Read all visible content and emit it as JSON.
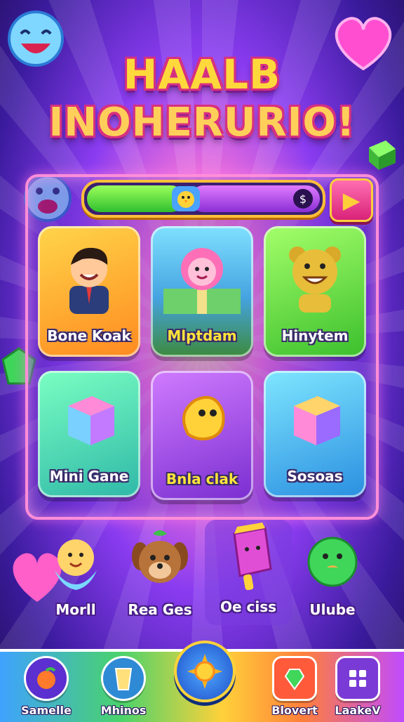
{
  "title": {
    "line1": "HAALB",
    "line2": "INOHERURIO!"
  },
  "progress": {
    "fraction": 0.43
  },
  "tiles": [
    {
      "label": "Bone Koak",
      "color": "#ff9a1f"
    },
    {
      "label": "Mlptdam",
      "color": "#59c7ff"
    },
    {
      "label": "Hinytem",
      "color": "#5ad43c"
    },
    {
      "label": "Mini Gane",
      "color": "#4de08a"
    },
    {
      "label": "Bnla clak",
      "color": "#a247f0"
    },
    {
      "label": "Sosoas",
      "color": "#3ab4ff"
    }
  ],
  "characters": [
    {
      "label": "Morll"
    },
    {
      "label": "Rea Ges"
    },
    {
      "label": "Oe ciss"
    },
    {
      "label": "Ulube"
    }
  ],
  "nav": [
    {
      "label": "Samelle",
      "icon": "peach-icon"
    },
    {
      "label": "Mhinos",
      "icon": "juice-glass-icon"
    },
    {
      "label": "",
      "icon": "sun-icon"
    },
    {
      "label": "Blovert",
      "icon": "gem-heart-icon"
    },
    {
      "label": "LaakeV",
      "icon": "grid-icon"
    }
  ],
  "colors": {
    "accent": "#ffd93b",
    "title_outline": "#d8307f",
    "board_border": "#ff8ed8"
  }
}
